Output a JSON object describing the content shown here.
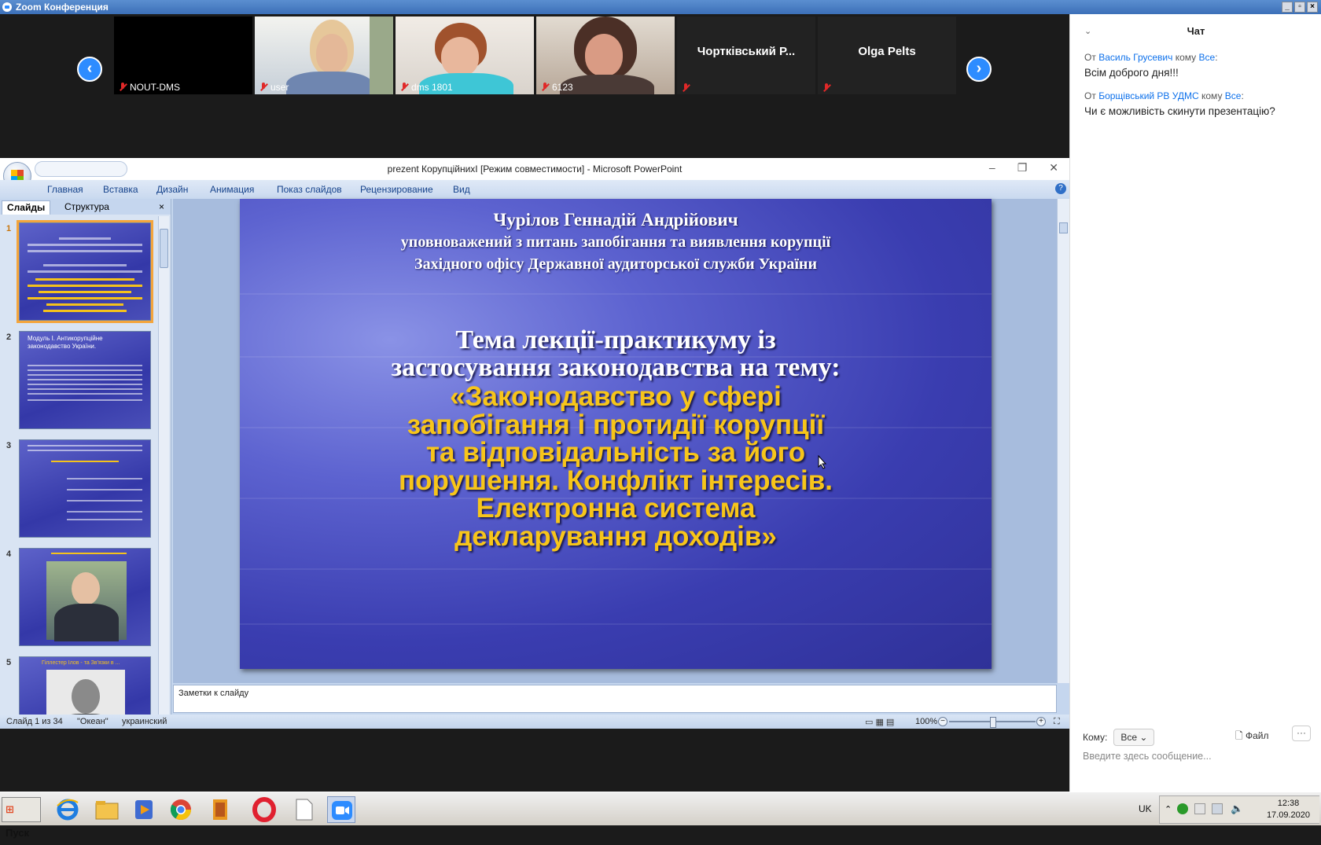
{
  "zoom": {
    "title": "Zoom Конференция",
    "participants": [
      {
        "name": "NOUT-DMS"
      },
      {
        "name": "user"
      },
      {
        "name": "dms 1801"
      },
      {
        "name": "6123"
      },
      {
        "name": "Чортківський  Р..."
      },
      {
        "name": "Olga Pelts"
      }
    ],
    "nav_prev": "‹",
    "nav_next": "›"
  },
  "ppt": {
    "title": "prezent КорупційнихI [Режим совместимости] - Microsoft PowerPoint",
    "tabs": [
      "Главная",
      "Вставка",
      "Дизайн",
      "Анимация",
      "Показ слайдов",
      "Рецензирование",
      "Вид"
    ],
    "pane_tabs": [
      "Слайды",
      "Структура"
    ],
    "pane_close": "×",
    "thumb_numbers": [
      "1",
      "2",
      "3",
      "4",
      "5"
    ],
    "thumb2_title": "Модуль І. Антикорупційне законодавство України.",
    "thumb5_title": "Гіллестер Ілов - та Зв'язки в ...",
    "slide": {
      "author_name": "Чурілов Геннадій Андрійович",
      "author_line2": "уповноважений з питань запобігання та виявлення корупції",
      "author_line3": "Західного офісу Державної аудиторської служби України",
      "topic_line1": "Тема лекції-практикуму із",
      "topic_line2": "застосування законодавства на тему:",
      "quote_lines": [
        "«Законодавство у сфері",
        "запобігання і протидії корупції",
        "та відповідальність за його",
        "порушення. Конфлікт інтересів.",
        "Електронна система",
        "декларування доходів»"
      ]
    },
    "notes_placeholder": "Заметки к слайду",
    "status": {
      "slide_of": "Слайд 1 из 34",
      "theme": "\"Океан\"",
      "language": "украинский",
      "zoom": "100%"
    }
  },
  "chat": {
    "title": "Чат",
    "messages": [
      {
        "from_prefix": "От",
        "sender": "Василь Грусевич",
        "to_prefix": "кому",
        "recipient": "Все",
        "text": "Всім доброго дня!!!"
      },
      {
        "from_prefix": "От",
        "sender": "Борщівський РВ УДМС",
        "to_prefix": "кому",
        "recipient": "Все",
        "text": "Чи є можливість скинути презентацію?"
      }
    ],
    "to_label": "Кому:",
    "to_value": "Все",
    "file_label": "Файл",
    "more_label": "···",
    "input_placeholder": "Введите здесь сообщение..."
  },
  "taskbar": {
    "start_label": "Пуск",
    "language": "UK",
    "time": "12:38",
    "date": "17.09.2020"
  },
  "colors": {
    "zoom_blue": "#2d8cff",
    "slide_yellow": "#f7c51a",
    "slide_blue": "#3a3db0"
  }
}
